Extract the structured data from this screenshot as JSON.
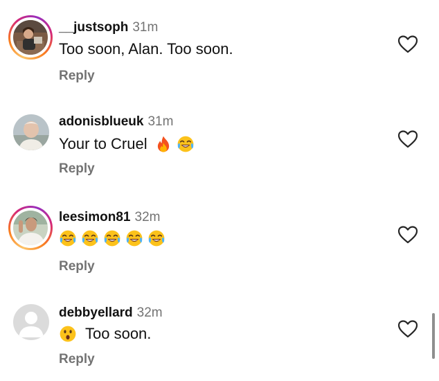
{
  "comments": [
    {
      "username": "__justsoph",
      "time": "31m",
      "text": "Too soon, Alan. Too soon.",
      "reply_label": "Reply",
      "avatar_ring": true,
      "emojis_after": [],
      "emojis_before": []
    },
    {
      "username": "adonisblueuk",
      "time": "31m",
      "text": "Your to Cruel",
      "reply_label": "Reply",
      "avatar_ring": false,
      "emojis_after": [
        "fire",
        "tears-of-joy"
      ],
      "emojis_before": []
    },
    {
      "username": "leesimon81",
      "time": "32m",
      "text": "",
      "reply_label": "Reply",
      "avatar_ring": true,
      "emojis_after": [
        "tears-of-joy",
        "tears-of-joy",
        "tears-of-joy",
        "tears-of-joy",
        "tears-of-joy"
      ],
      "emojis_before": []
    },
    {
      "username": "debbyellard",
      "time": "32m",
      "text": "Too soon.",
      "reply_label": "Reply",
      "avatar_ring": false,
      "emojis_after": [],
      "emojis_before": [
        "surprised"
      ]
    }
  ],
  "colors": {
    "text": "#111111",
    "muted": "#737373",
    "ring_start": "#fdc468",
    "ring_end": "#962fbf",
    "heart_stroke": "#262626"
  },
  "icons": {
    "like": "heart-outline-icon"
  }
}
